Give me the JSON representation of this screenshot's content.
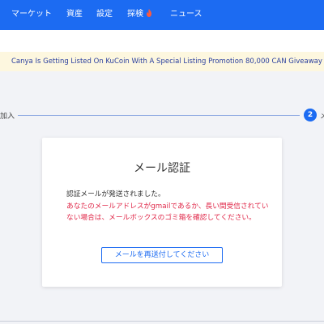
{
  "nav": {
    "market": "マーケット",
    "assets": "資産",
    "settings": "設定",
    "explore": "探検",
    "news": "ニュース"
  },
  "banner": {
    "text": "Canya Is Getting Listed On KuCoin With A Special Listing Promotion 80,000 CAN Giveaway"
  },
  "stepper": {
    "step1_label": "加入",
    "step2_number": "2",
    "step2_label": "メ"
  },
  "card": {
    "title": "メール認証",
    "message": "認証メールが発送されました。",
    "warning": "あなたのメールアドレスがgmailであるか、長い間受信されていない場合は、メールボックスのゴミ箱を確認してください。",
    "resend_button": "メールを再送付してください"
  },
  "colors": {
    "primary": "#1c6bf2",
    "warning": "#e0294a",
    "banner_bg": "#fdf7df",
    "banner_text": "#2a3f9e"
  }
}
